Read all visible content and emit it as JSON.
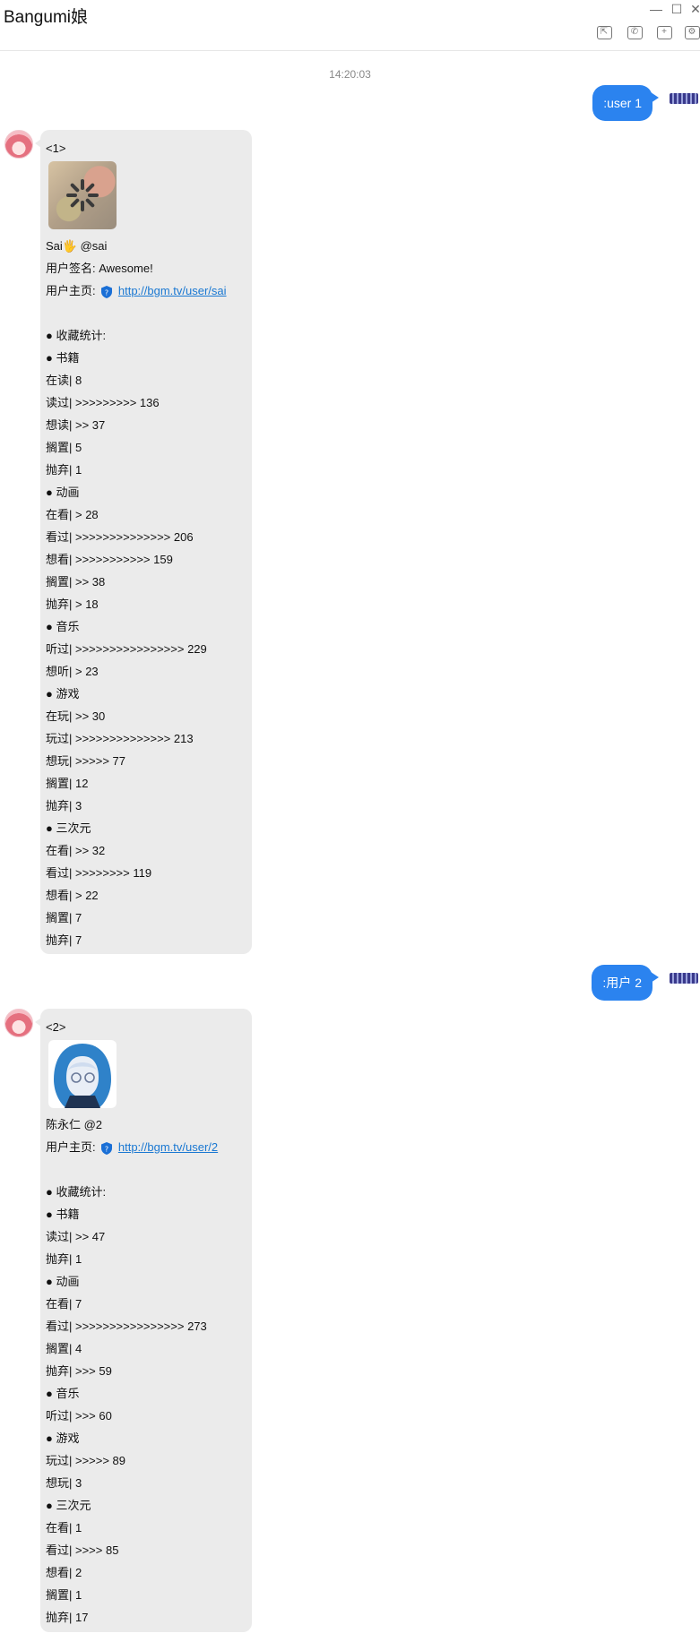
{
  "window": {
    "title": "Bangumi娘",
    "controls": {
      "minimize": "—",
      "maximize": "☐",
      "close": "✕"
    },
    "toolbar": [
      {
        "icon": "screen-share-icon",
        "glyph": "⇱"
      },
      {
        "icon": "phone-icon",
        "glyph": "✆"
      },
      {
        "icon": "add-icon",
        "glyph": "+"
      },
      {
        "icon": "settings-icon",
        "glyph": "⚙"
      }
    ]
  },
  "chat": {
    "timestamp": "14:20:03",
    "messages": [
      {
        "sender": "user",
        "text": ":user 1"
      },
      {
        "sender": "bot",
        "index": "<1>",
        "name_line": "Sai🖐 @sai",
        "signature": "用户签名: Awesome!",
        "home_label": "用户主页:",
        "home_link": "http://bgm.tv/user/sai",
        "stats": [
          "● 收藏统计:",
          "● 书籍",
          "在读|  8",
          "读过| >>>>>>>>> 136",
          "想读| >> 37",
          "搁置|  5",
          "抛弃|  1",
          "● 动画",
          "在看| > 28",
          "看过| >>>>>>>>>>>>>> 206",
          "想看| >>>>>>>>>>> 159",
          "搁置| >> 38",
          "抛弃| > 18",
          "● 音乐",
          "听过| >>>>>>>>>>>>>>>> 229",
          "想听| > 23",
          "● 游戏",
          "在玩| >> 30",
          "玩过| >>>>>>>>>>>>>> 213",
          "想玩| >>>>> 77",
          "搁置|  12",
          "抛弃|  3",
          "● 三次元",
          "在看| >> 32",
          "看过| >>>>>>>> 119",
          "想看| > 22",
          "搁置|  7",
          "抛弃|  7"
        ]
      },
      {
        "sender": "user",
        "text": ":用户 2"
      },
      {
        "sender": "bot",
        "index": "<2>",
        "name_line": "陈永仁 @2",
        "home_label": "用户主页:",
        "home_link": "http://bgm.tv/user/2",
        "stats": [
          "● 收藏统计:",
          "● 书籍",
          "读过| >> 47",
          "抛弃|  1",
          "● 动画",
          "在看|  7",
          "看过| >>>>>>>>>>>>>>>> 273",
          "搁置|  4",
          "抛弃| >>> 59",
          "● 音乐",
          "听过| >>> 60",
          "● 游戏",
          "玩过| >>>>> 89",
          "想玩|  3",
          "● 三次元",
          "在看|  1",
          "看过| >>>> 85",
          "想看|  2",
          "搁置|  1",
          "抛弃|  17"
        ]
      }
    ]
  }
}
